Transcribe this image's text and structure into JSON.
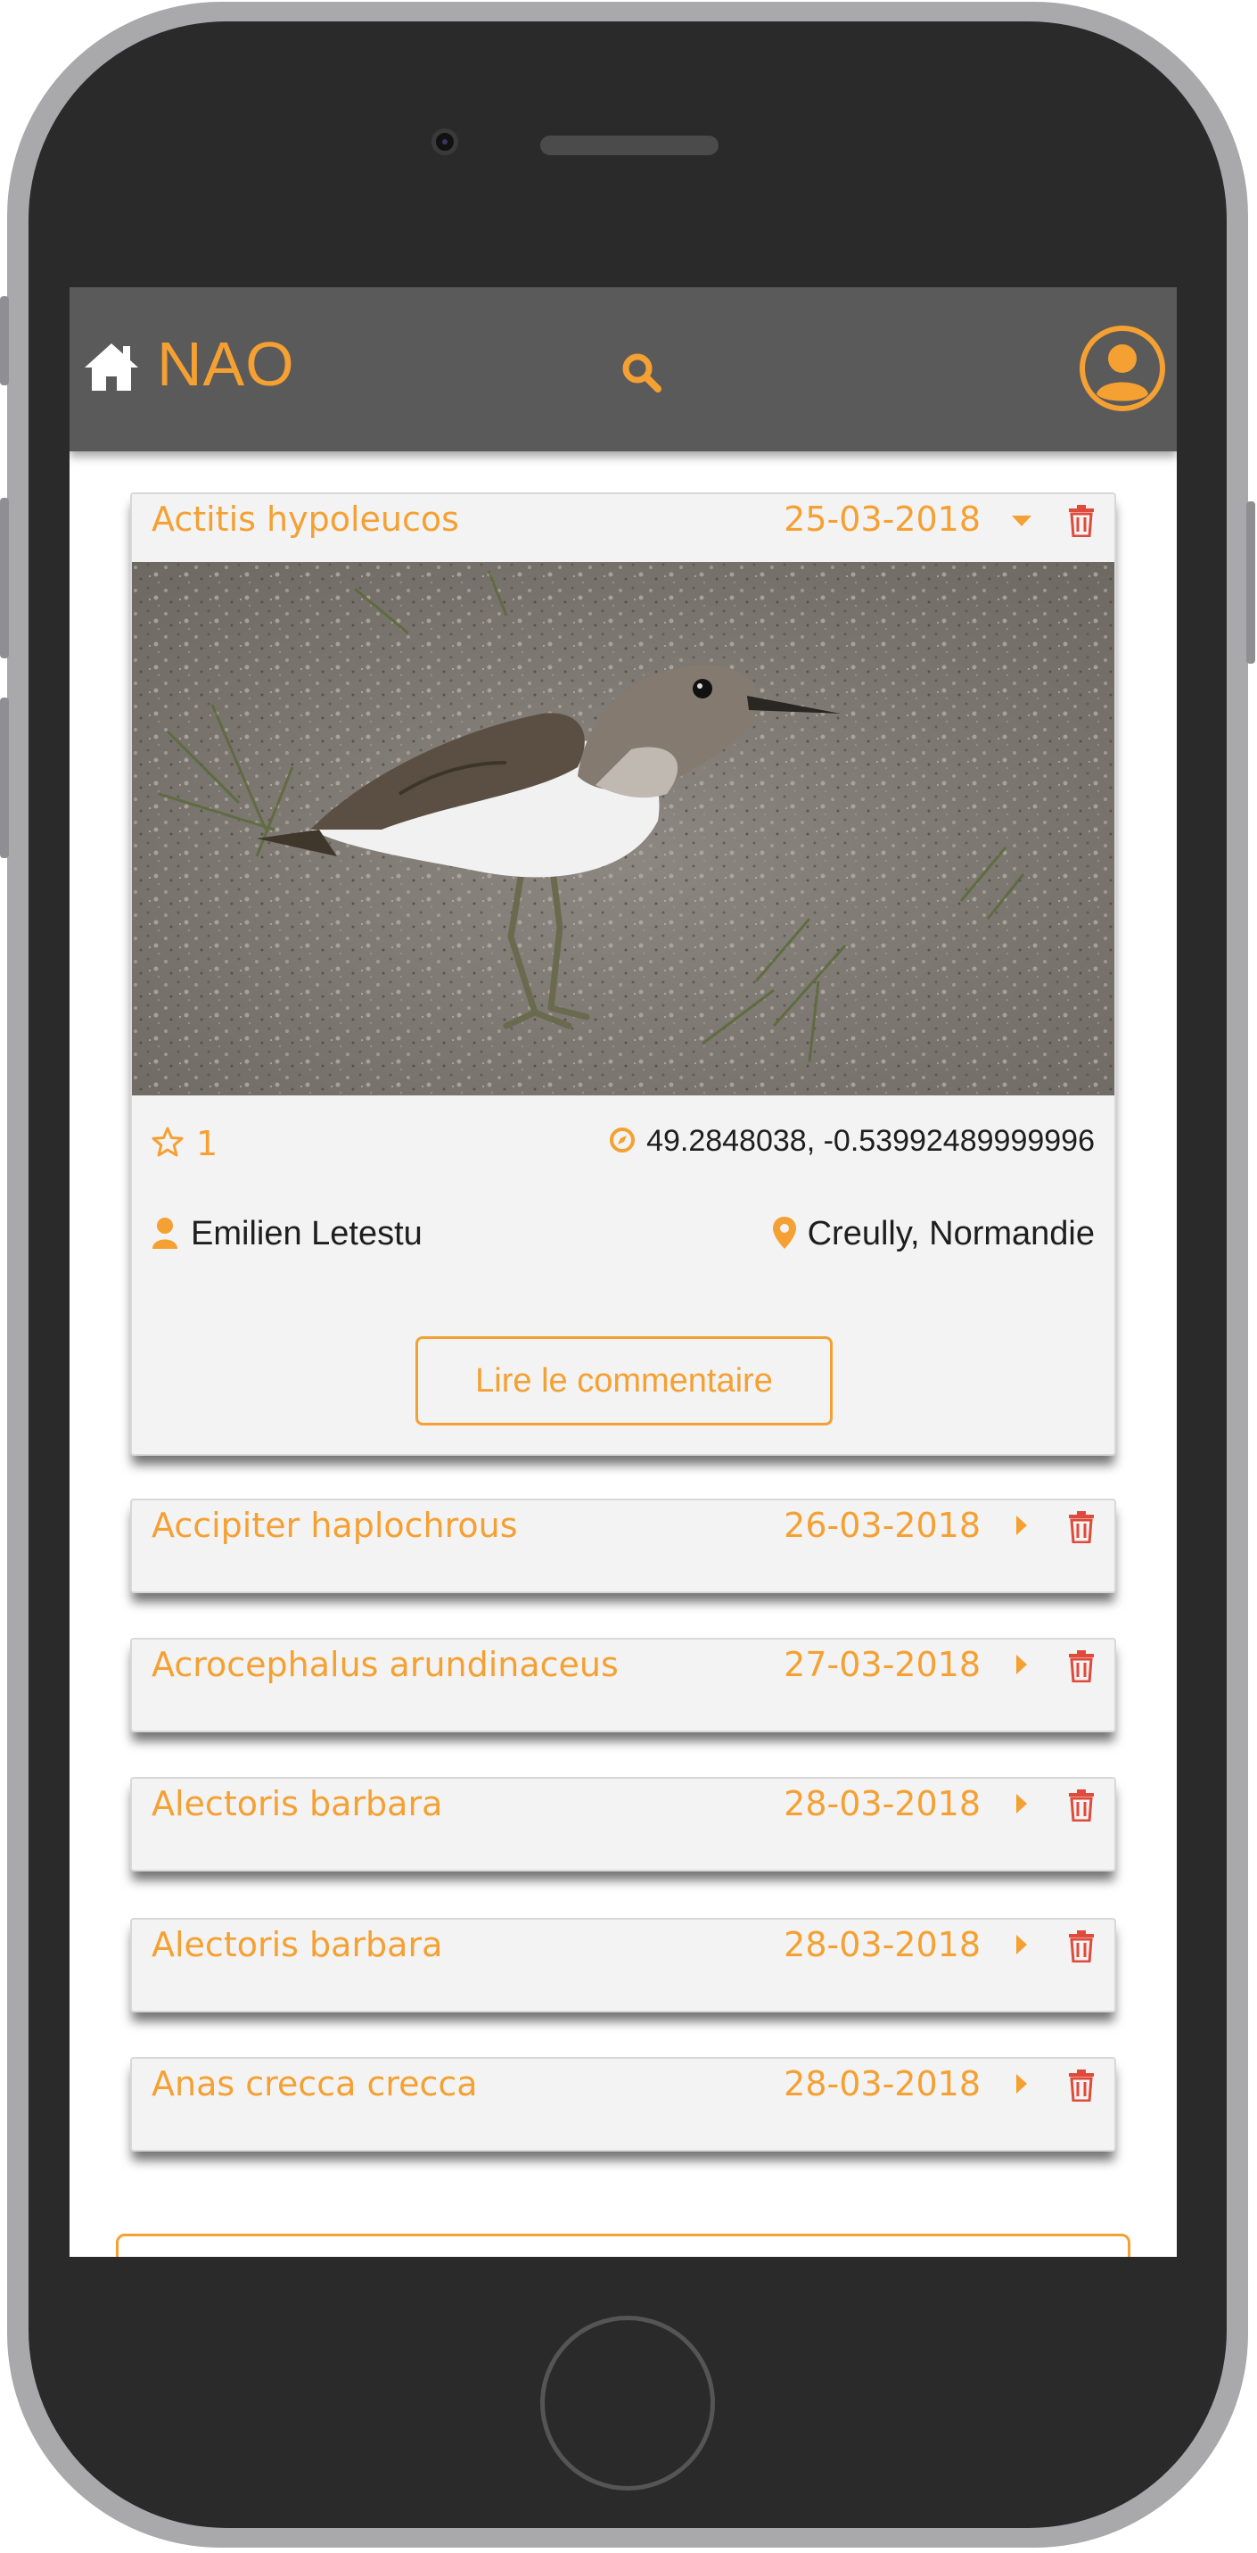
{
  "app": {
    "brand": "NAO",
    "accent_color": "#f5a032",
    "delete_color": "#e04a3a",
    "navbar_color": "#5a5a5a"
  },
  "navbar": {
    "home_icon": "home-icon",
    "search_icon": "search-icon",
    "profile_icon": "user-circle-icon"
  },
  "observations": [
    {
      "species": "Actitis hypoleucos",
      "date": "25-03-2018",
      "expanded": true,
      "stars": "1",
      "coordinates": "49.2848038, -0.53992489999996",
      "observer": "Emilien Letestu",
      "location": "Creully, Normandie",
      "comment_button": "Lire le commentaire"
    },
    {
      "species": "Accipiter haplochrous",
      "date": "26-03-2018",
      "expanded": false
    },
    {
      "species": "Acrocephalus arundinaceus",
      "date": "27-03-2018",
      "expanded": false
    },
    {
      "species": "Alectoris barbara",
      "date": "28-03-2018",
      "expanded": false
    },
    {
      "species": "Alectoris barbara",
      "date": "28-03-2018",
      "expanded": false
    },
    {
      "species": "Anas crecca crecca",
      "date": "28-03-2018",
      "expanded": false
    }
  ]
}
